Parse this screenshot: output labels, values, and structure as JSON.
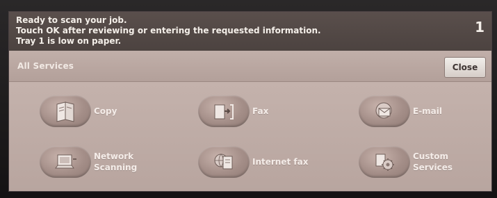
{
  "status": {
    "lines": [
      "Ready to scan your job.",
      "Touch OK after reviewing or entering the requested information.",
      "Tray 1 is low on paper."
    ],
    "count": "1"
  },
  "header": {
    "title": "All Services",
    "close_label": "Close"
  },
  "services": [
    {
      "label_lines": [
        "Copy"
      ],
      "icon": "copy-icon"
    },
    {
      "label_lines": [
        "Fax"
      ],
      "icon": "fax-icon"
    },
    {
      "label_lines": [
        "E-mail"
      ],
      "icon": "email-icon"
    },
    {
      "label_lines": [
        "Network",
        "Scanning"
      ],
      "icon": "network-scanning-icon"
    },
    {
      "label_lines": [
        "Internet fax"
      ],
      "icon": "internet-fax-icon"
    },
    {
      "label_lines": [
        "Custom",
        "Services"
      ],
      "icon": "custom-services-icon"
    }
  ]
}
